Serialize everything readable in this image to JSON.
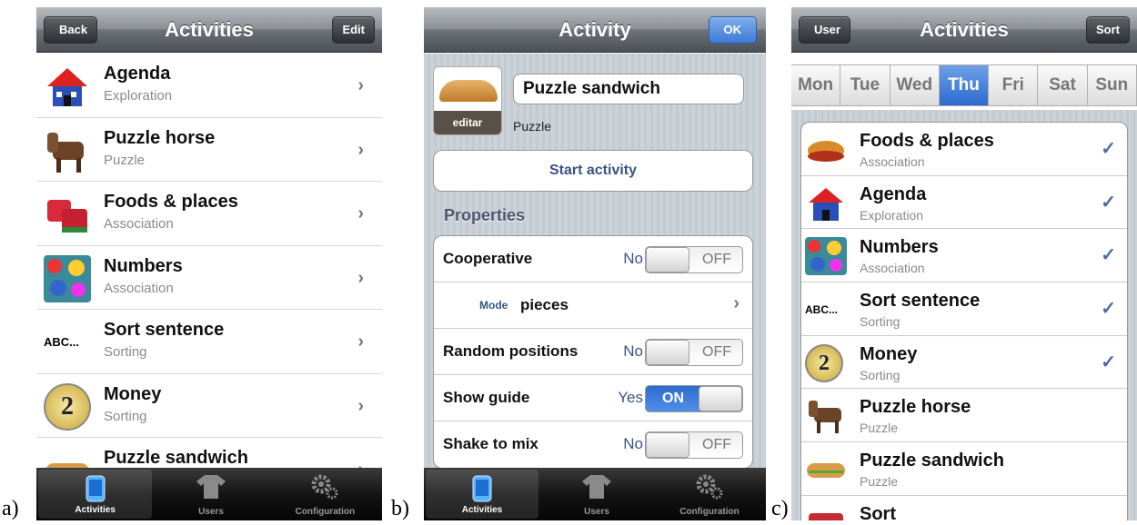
{
  "labels": {
    "a": "a)",
    "b": "b)",
    "c": "c)"
  },
  "tabbar": [
    {
      "label": "Activities",
      "icon": "phone-icon"
    },
    {
      "label": "Users",
      "icon": "shirt-icon"
    },
    {
      "label": "Configuration",
      "icon": "gears-icon"
    }
  ],
  "screen_a": {
    "title": "Activities",
    "back_label": "Back",
    "edit_label": "Edit",
    "items": [
      {
        "title": "Agenda",
        "subtitle": "Exploration"
      },
      {
        "title": "Puzzle horse",
        "subtitle": "Puzzle"
      },
      {
        "title": "Foods & places",
        "subtitle": "Association"
      },
      {
        "title": "Numbers",
        "subtitle": "Association"
      },
      {
        "title": "Sort sentence",
        "subtitle": "Sorting"
      },
      {
        "title": "Money",
        "subtitle": "Sorting"
      },
      {
        "title": "Puzzle sandwich",
        "subtitle": ""
      }
    ]
  },
  "screen_b": {
    "title": "Activity",
    "ok_label": "OK",
    "edit_image_label": "editar",
    "name_value": "Puzzle sandwich",
    "type": "Puzzle",
    "start_label": "Start activity",
    "section_title": "Properties",
    "cooperative": {
      "label": "Cooperative",
      "value": "No",
      "toggle": "OFF"
    },
    "mode": {
      "label": "Mode",
      "value": "pieces"
    },
    "random": {
      "label": "Random positions",
      "value": "No",
      "toggle": "OFF"
    },
    "guide": {
      "label": "Show guide",
      "value": "Yes",
      "toggle": "ON"
    },
    "shake": {
      "label": "Shake to mix",
      "value": "No",
      "toggle": "OFF"
    }
  },
  "screen_c": {
    "title": "Activities",
    "user_label": "User",
    "sort_label": "Sort",
    "days": [
      "Mon",
      "Tue",
      "Wed",
      "Thu",
      "Fri",
      "Sat",
      "Sun"
    ],
    "selected_day": "Thu",
    "items": [
      {
        "title": "Foods & places",
        "subtitle": "Association",
        "checked": true
      },
      {
        "title": "Agenda",
        "subtitle": "Exploration",
        "checked": true
      },
      {
        "title": "Numbers",
        "subtitle": "Association",
        "checked": true
      },
      {
        "title": "Sort sentence",
        "subtitle": "Sorting",
        "checked": true
      },
      {
        "title": "Money",
        "subtitle": "Sorting",
        "checked": true
      },
      {
        "title": "Puzzle horse",
        "subtitle": "Puzzle",
        "checked": false
      },
      {
        "title": "Puzzle sandwich",
        "subtitle": "Puzzle",
        "checked": false
      },
      {
        "title": "Sort",
        "subtitle": "",
        "checked": false
      }
    ],
    "check_glyph": "✓"
  },
  "abc_thumb_text": "ABC...",
  "money_thumb_text": "2",
  "chevron_glyph": "›"
}
